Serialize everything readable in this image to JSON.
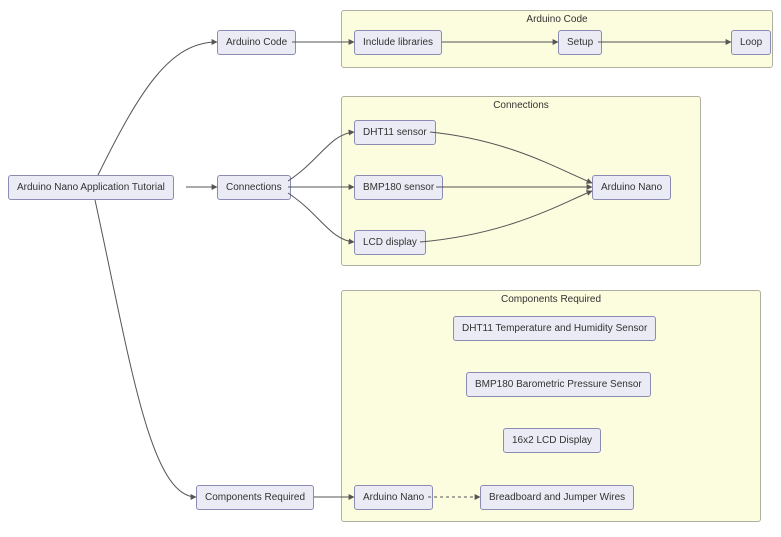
{
  "chart_data": {
    "type": "flowchart",
    "root": "Arduino Nano Application Tutorial",
    "groups": [
      {
        "id": "arduino_code",
        "label": "Arduino Code",
        "nodes": [
          "Include libraries",
          "Setup",
          "Loop"
        ],
        "edges": [
          [
            "Include libraries",
            "Setup"
          ],
          [
            "Setup",
            "Loop"
          ]
        ]
      },
      {
        "id": "connections",
        "label": "Connections",
        "nodes": [
          "DHT11 sensor",
          "BMP180 sensor",
          "LCD display",
          "Arduino Nano"
        ],
        "edges": [
          [
            "DHT11 sensor",
            "Arduino Nano"
          ],
          [
            "BMP180 sensor",
            "Arduino Nano"
          ],
          [
            "LCD display",
            "Arduino Nano"
          ]
        ]
      },
      {
        "id": "components_required",
        "label": "Components Required",
        "nodes": [
          "Arduino Nano",
          "DHT11 Temperature and Humidity Sensor",
          "BMP180 Barometric Pressure Sensor",
          "16x2 LCD Display",
          "Breadboard and Jumper Wires"
        ],
        "edges": [
          [
            "Arduino Nano",
            "Breadboard and Jumper Wires",
            "dashed"
          ]
        ]
      }
    ],
    "root_edges": [
      [
        "Arduino Nano Application Tutorial",
        "Arduino Code"
      ],
      [
        "Arduino Nano Application Tutorial",
        "Connections"
      ],
      [
        "Arduino Nano Application Tutorial",
        "Components Required"
      ]
    ],
    "bridge_edges": [
      [
        "Arduino Code",
        "Include libraries"
      ],
      [
        "Connections",
        "DHT11 sensor"
      ],
      [
        "Connections",
        "BMP180 sensor"
      ],
      [
        "Connections",
        "LCD display"
      ],
      [
        "Components Required",
        "Arduino Nano (components)"
      ]
    ]
  },
  "nodes": {
    "root": "Arduino Nano Application Tutorial",
    "arduino_code_label": "Arduino Code",
    "connections_label": "Connections",
    "components_label": "Components Required",
    "g_code": {
      "title": "Arduino Code",
      "include": "Include libraries",
      "setup": "Setup",
      "loop": "Loop"
    },
    "g_conn": {
      "title": "Connections",
      "dht11": "DHT11 sensor",
      "bmp180": "BMP180 sensor",
      "lcd": "LCD display",
      "nano": "Arduino Nano"
    },
    "g_comp": {
      "title": "Components Required",
      "nano": "Arduino Nano",
      "dht11_full": "DHT11 Temperature and Humidity Sensor",
      "bmp180_full": "BMP180 Barometric Pressure Sensor",
      "lcd_full": "16x2 LCD Display",
      "bb": "Breadboard and Jumper Wires"
    }
  }
}
